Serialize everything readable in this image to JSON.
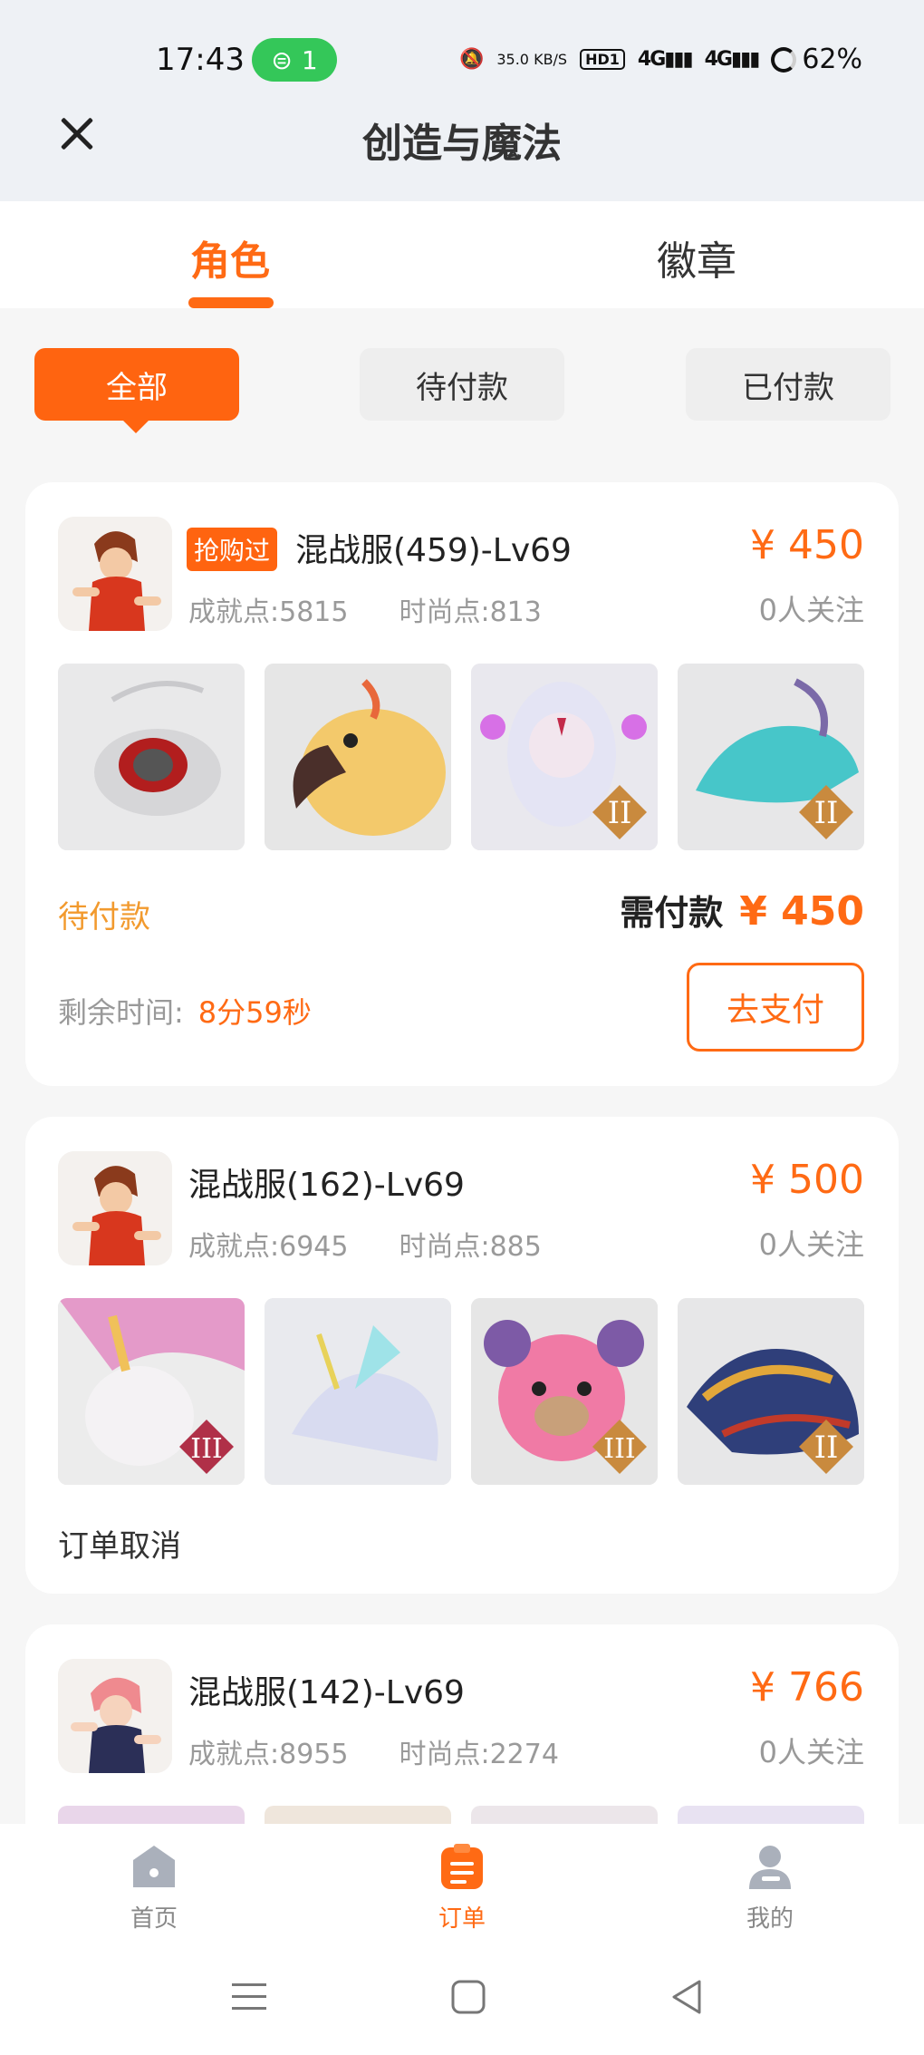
{
  "status_bar": {
    "time": "17:43",
    "hotspot_count": "1",
    "net_speed": "35.0 KB/S",
    "hd": "HD1",
    "sig1": "4G",
    "sig2": "4G",
    "battery": "62%"
  },
  "header": {
    "title": "创造与魔法",
    "close_icon": "close-icon"
  },
  "main_tabs": [
    {
      "label": "角色",
      "active": true
    },
    {
      "label": "徽章",
      "active": false
    }
  ],
  "filters": [
    {
      "label": "全部",
      "active": true
    },
    {
      "label": "待付款",
      "active": false
    },
    {
      "label": "已付款",
      "active": false
    }
  ],
  "orders": [
    {
      "tag": "抢购过",
      "server": "混战服(459)-Lv69",
      "achievement": "成就点:5815",
      "fashion": "时尚点:813",
      "price": "¥ 450",
      "followers": "0人关注",
      "status": "待付款",
      "need_pay_label": "需付款",
      "need_pay_amount": "¥ 450",
      "remain_label": "剩余时间:",
      "remain_time": "8分59秒",
      "pay_button": "去支付"
    },
    {
      "server": "混战服(162)-Lv69",
      "achievement": "成就点:6945",
      "fashion": "时尚点:885",
      "price": "¥ 500",
      "followers": "0人关注",
      "status": "订单取消"
    },
    {
      "server": "混战服(142)-Lv69",
      "achievement": "成就点:8955",
      "fashion": "时尚点:2274",
      "price": "¥ 766",
      "followers": "0人关注"
    }
  ],
  "bottom_nav": [
    {
      "label": "首页",
      "icon": "home-icon",
      "active": false
    },
    {
      "label": "订单",
      "icon": "order-icon",
      "active": true
    },
    {
      "label": "我的",
      "icon": "profile-icon",
      "active": false
    }
  ],
  "colors": {
    "accent": "#ff6a14",
    "pending": "#f29a2e"
  }
}
